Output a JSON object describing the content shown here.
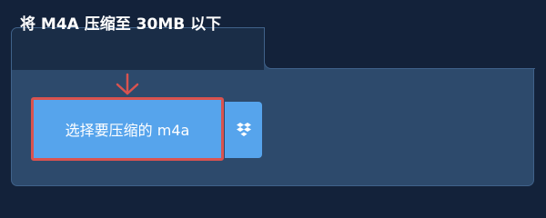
{
  "header": {
    "title": "将 M4A 压缩至 30MB 以下"
  },
  "upload": {
    "select_label": "选择要压缩的 m4a",
    "dropbox_icon": "dropbox-icon"
  },
  "colors": {
    "background": "#13223a",
    "card": "#2d4a6c",
    "button": "#56a4ec",
    "highlight": "#d9534f"
  }
}
